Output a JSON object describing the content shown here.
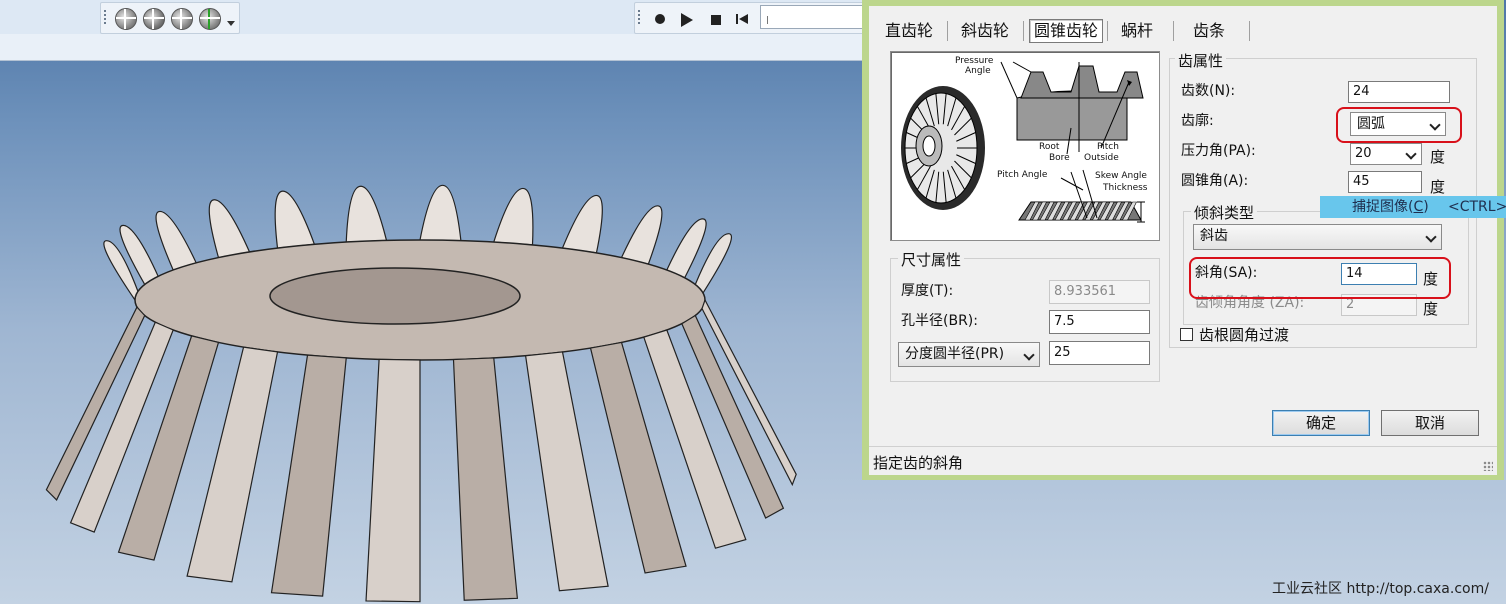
{
  "dialog": {
    "tabs": [
      {
        "label": "直齿轮"
      },
      {
        "label": "斜齿轮"
      },
      {
        "label": "圆锥齿轮",
        "active": true
      },
      {
        "label": "蜗杆"
      },
      {
        "label": "齿条"
      }
    ],
    "preview": {
      "labels": {
        "pressure": "Pressure",
        "angle": "Angle",
        "root": "Root",
        "pitch": "Pitch",
        "bore": "Bore",
        "outside": "Outside",
        "pitch_angle": "Pitch Angle",
        "skew_angle": "Skew Angle",
        "thickness": "Thickness"
      }
    },
    "tooth_props": {
      "title": "齿属性",
      "count_label": "齿数(N):",
      "count_value": "24",
      "profile_label": "齿廓:",
      "profile_value": "圆弧",
      "pressure_label": "压力角(PA):",
      "pressure_value": "20",
      "cone_label": "圆锥角(A):",
      "cone_value": "45",
      "unit": "度"
    },
    "skew_type": {
      "title": "倾斜类型",
      "type_value": "斜齿",
      "skew_label": "斜角(SA):",
      "skew_value": "14",
      "lean_label": "齿倾角角度 (ZA):",
      "lean_value": "2",
      "unit": "度"
    },
    "root_fillet_label": "齿根圆角过渡",
    "size_props": {
      "title": "尺寸属性",
      "thickness_label": "厚度(T):",
      "thickness_value": "8.933561",
      "bore_label": "孔半径(BR):",
      "bore_value": "7.5",
      "pitch_select": "分度圆半径(PR)",
      "pitch_value": "25"
    },
    "ok_label": "确定",
    "cancel_label": "取消",
    "status_text": "指定齿的斜角"
  },
  "tooltip": {
    "label": "捕捉图像(",
    "accel": "C",
    "label_end": ")",
    "shortcut": "<CTRL>"
  },
  "watermark": "工业云社区 http://top.caxa.com/",
  "colors": {
    "dialog_frame": "#bcd68c",
    "highlight": "#d8101a",
    "tooltip": "#68c6ec",
    "gear": "#b5a9a0"
  },
  "icons": [
    "view-orientation-icon",
    "play-icon",
    "stop-icon",
    "rewind-icon",
    "record-icon"
  ]
}
